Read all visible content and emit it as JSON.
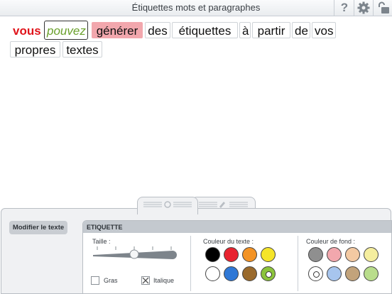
{
  "app": {
    "title": "Étiquettes mots et paragraphes"
  },
  "toolbar": {
    "help": "?",
    "settings": "settings",
    "lock": "lock"
  },
  "words": [
    {
      "text": "vous",
      "style": "red"
    },
    {
      "text": "pouvez",
      "style": "selected"
    },
    {
      "text": "générer",
      "style": "pink"
    },
    {
      "text": "des",
      "style": "normal"
    },
    {
      "text": "étiquettes",
      "style": "normal"
    },
    {
      "text": "à",
      "style": "normal"
    },
    {
      "text": "partir",
      "style": "normal"
    },
    {
      "text": "de",
      "style": "normal"
    },
    {
      "text": "vos",
      "style": "normal"
    },
    {
      "text": "propres",
      "style": "normal"
    },
    {
      "text": "textes",
      "style": "normal"
    }
  ],
  "panel": {
    "modify_button": "Modifier le texte",
    "section_title": "ETIQUETTE",
    "size_label": "Taille :",
    "bold_label": "Gras",
    "italic_label": "Italique",
    "bold_checked": false,
    "italic_checked": true,
    "text_color_label": "Couleur du texte :",
    "bg_color_label": "Couleur de fond :",
    "text_colors": [
      "#000000",
      "#e8232f",
      "#f39325",
      "#f5e52a",
      "#ffffff",
      "#2f78d6",
      "#9a6a2c",
      "#8cc43c"
    ],
    "text_color_selected": 7,
    "bg_colors": [
      "#8f8f8f",
      "#f2a7ad",
      "#f3c9a2",
      "#f5ee9e",
      "#ffffff",
      "#a7c5ee",
      "#c2a37b",
      "#b9dd8c"
    ],
    "bg_color_selected": 4
  }
}
